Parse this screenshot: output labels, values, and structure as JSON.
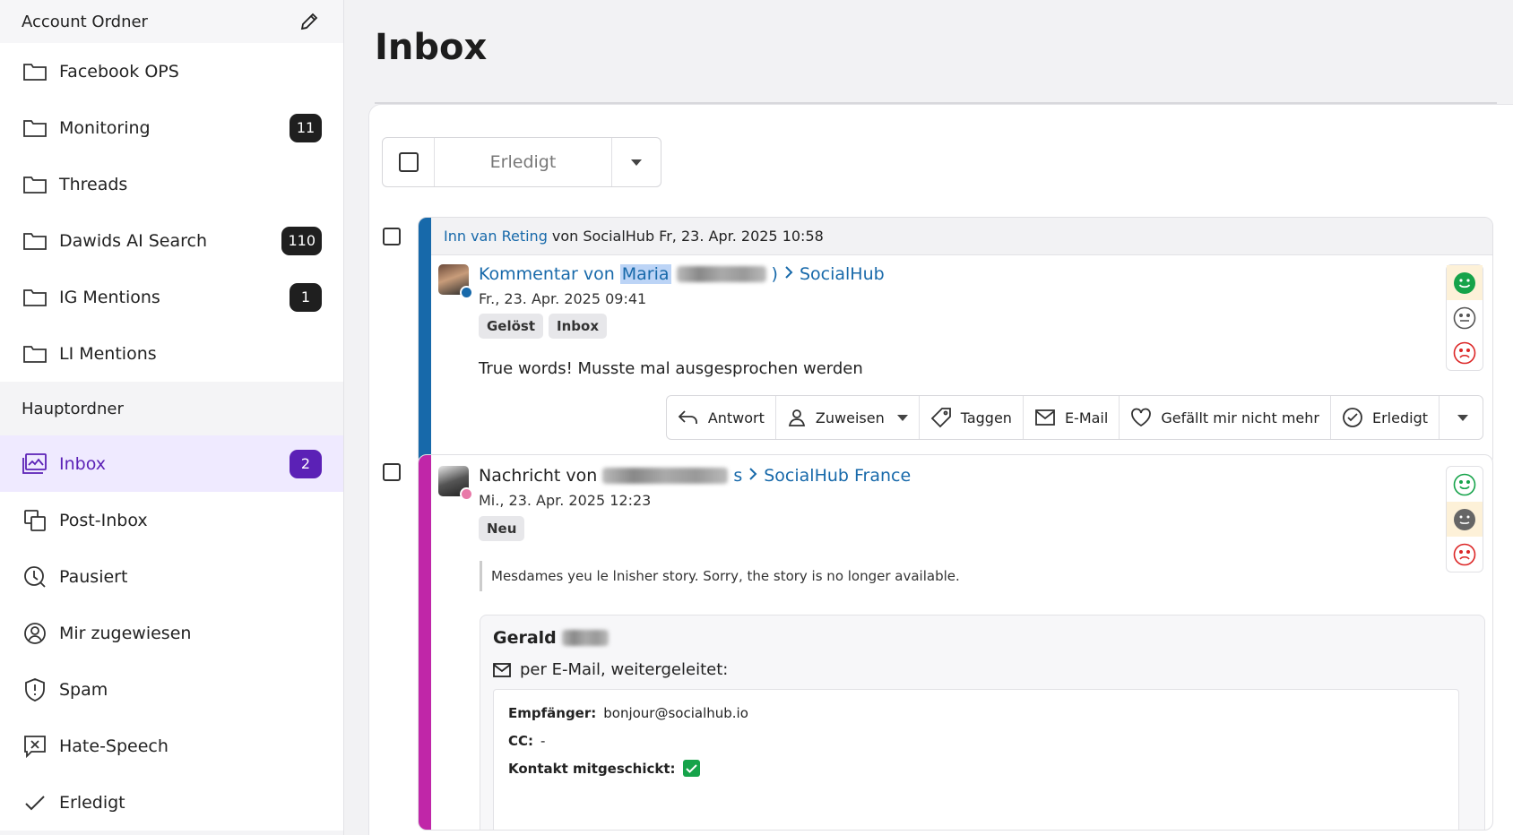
{
  "sidebar": {
    "account_header": "Account Ordner",
    "account_folders": [
      {
        "label": "Facebook OPS",
        "count": ""
      },
      {
        "label": "Monitoring",
        "count": "11"
      },
      {
        "label": "Threads",
        "count": ""
      },
      {
        "label": "Dawids AI Search",
        "count": "110"
      },
      {
        "label": "IG Mentions",
        "count": "1"
      },
      {
        "label": "LI Mentions",
        "count": ""
      }
    ],
    "main_header": "Hauptordner",
    "main_items": [
      {
        "label": "Inbox",
        "count": "2",
        "icon": "inbox-icon"
      },
      {
        "label": "Post-Inbox",
        "icon": "post-inbox-icon"
      },
      {
        "label": "Pausiert",
        "icon": "paused-clock-icon"
      },
      {
        "label": "Mir zugewiesen",
        "icon": "user-circle-icon"
      },
      {
        "label": "Spam",
        "icon": "shield-icon"
      },
      {
        "label": "Hate-Speech",
        "icon": "hate-speech-icon"
      },
      {
        "label": "Erledigt",
        "icon": "checkmark-icon"
      }
    ]
  },
  "main": {
    "title": "Inbox",
    "bulk_action_label": "Erledigt"
  },
  "cards": [
    {
      "header_user": "Inn van Reting",
      "header_rest": "von SocialHub Fr, 23. Apr. 2025 10:58",
      "title_prefix": "Kommentar von",
      "author_first": "Maria",
      "author_suffix": ")",
      "channel": "SocialHub",
      "date": "Fr., 23. Apr. 2025 09:41",
      "tags": [
        "Gelöst",
        "Inbox"
      ],
      "text": "True words! Musste mal ausgesprochen werden",
      "actions": [
        "Antwort",
        "Zuweisen",
        "Taggen",
        "E-Mail",
        "Gefällt mir nicht mehr",
        "Erledigt"
      ]
    },
    {
      "title_prefix": "Nachricht von",
      "author_suffix": "s",
      "channel": "SocialHub France",
      "date": "Mi., 23. Apr. 2025 12:23",
      "tags": [
        "Neu"
      ],
      "quote": "Mesdames yeu le lnisher story. Sorry, the story is no longer available.",
      "email": {
        "name": "Gerald",
        "via": "per E-Mail, weitergeleitet:",
        "recipient_label": "Empfänger:",
        "recipient": "bonjour@socialhub.io",
        "cc_label": "CC:",
        "cc": "-",
        "contact_label": "Kontakt mitgeschickt:"
      }
    }
  ],
  "colors": {
    "accent": "#5b21b6",
    "link": "#1769aa",
    "card1_bar": "#1769aa",
    "card2_bar": "#c026a8",
    "positive": "#16a34a",
    "negative": "#dc2626"
  }
}
